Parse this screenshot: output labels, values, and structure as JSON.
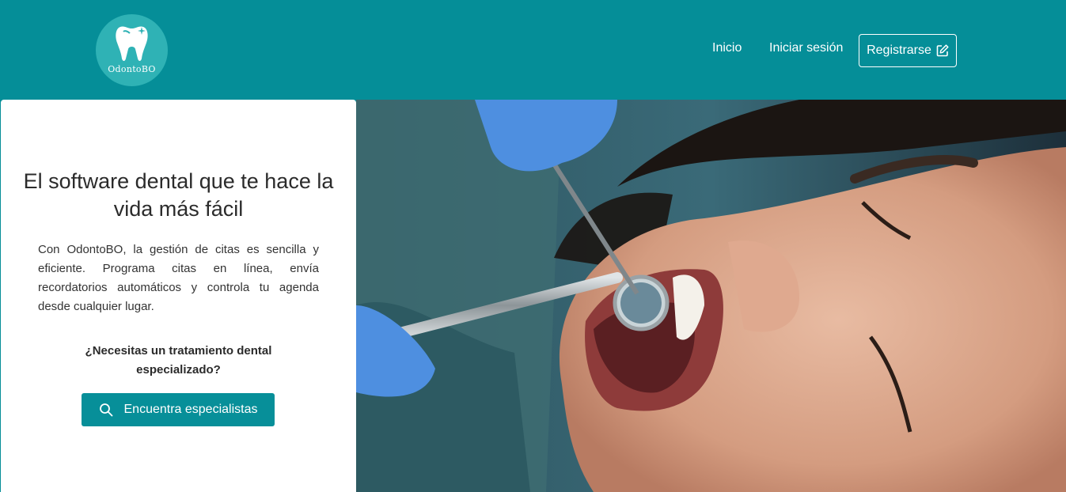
{
  "brand": {
    "logo_text": "OdontoBO",
    "primary_color": "#058e98",
    "logo_circle_color": "#2fb2b5",
    "logo_icon": "tooth-icon"
  },
  "nav": {
    "home_label": "Inicio",
    "login_label": "Iniciar sesión",
    "register_label": "Registrarse",
    "register_icon": "edit-icon"
  },
  "hero": {
    "title": "El software dental que te hace la vida más fácil",
    "description": "Con OdontoBO, la gestión de citas es sencilla y eficiente. Programa citas en línea, envía recordatorios automáticos y controla tu agenda desde cualquier lugar.",
    "question": "¿Necesitas un tratamiento dental especializado?",
    "cta_label": "Encuentra especialistas",
    "cta_icon": "search-icon",
    "image_subject": "dental-patient-photo"
  }
}
